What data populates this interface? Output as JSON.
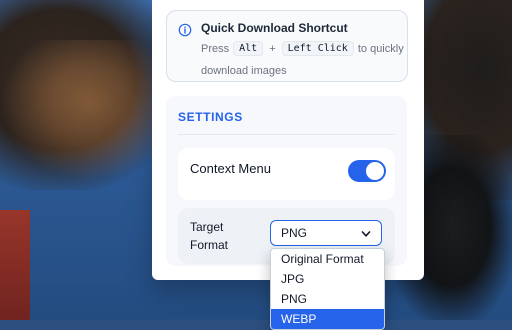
{
  "shortcut": {
    "title": "Quick Download Shortcut",
    "text_before": "Press",
    "key1": "Alt",
    "plus": "+",
    "key2": "Left Click",
    "text_after": "to quickly",
    "text_line2": "download images",
    "icon": "info-icon"
  },
  "settings": {
    "title": "SETTINGS",
    "context_menu": {
      "label": "Context Menu",
      "enabled": true
    },
    "target_format": {
      "label": "Target Format",
      "value": "PNG",
      "options": [
        "Original Format",
        "JPG",
        "PNG",
        "WEBP"
      ],
      "highlighted_option": "WEBP"
    }
  },
  "colors": {
    "accent": "#2563eb"
  }
}
